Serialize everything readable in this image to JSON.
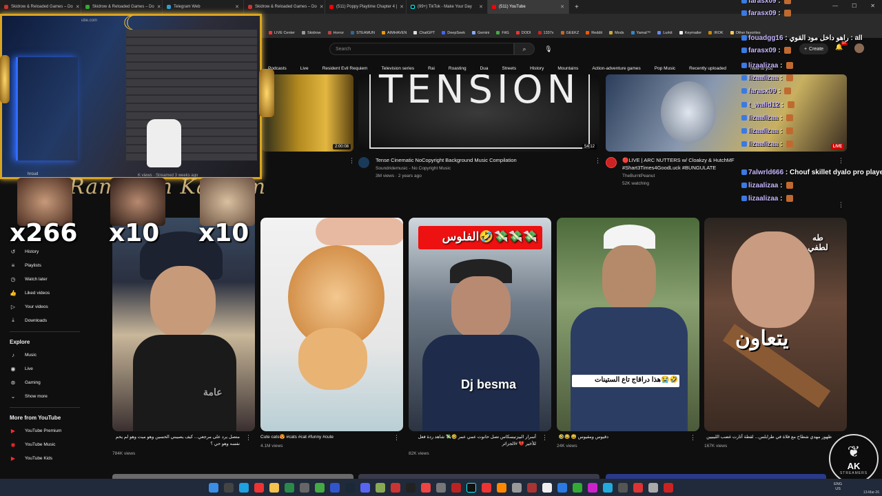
{
  "tabs": [
    {
      "label": "Skidrow & Reloaded Games – Do"
    },
    {
      "label": "Skidrow & Reloaded Games – Do"
    },
    {
      "label": "Telegram Web"
    },
    {
      "label": "Skidrow & Reloaded Games – Do"
    },
    {
      "label": "(511) Poppy Playtime Chapter 4 |"
    },
    {
      "label": "(99+) TikTok - Make Your Day"
    },
    {
      "label": "(511) YouTube"
    }
  ],
  "bookmarks": [
    "LIVE Center",
    "Skidrow",
    "Horror",
    "STEAMUN",
    "AIMHAVEN",
    "ChatGPT",
    "DeepSeek",
    "Gemini",
    "FitG",
    "DODI",
    "1337x",
    "GEEKZ",
    "Reddit",
    "Mods",
    "Yamal™",
    "Lurkit",
    "Keymailer",
    "IROK",
    "Other favorites"
  ],
  "header": {
    "search_placeholder": "Search",
    "create_label": "Create",
    "notif_badge": "9+"
  },
  "chips": [
    "Podcasts",
    "Live",
    "Resident Evil Requiem",
    "Television series",
    "Rai",
    "Roasting",
    "Dua",
    "Streets",
    "History",
    "Mountains",
    "Action-adventure games",
    "Pop Music",
    "Recently uploaded",
    "New to you"
  ],
  "sidebar": {
    "items": [
      {
        "label": "History",
        "icon": "history-icon"
      },
      {
        "label": "Playlists",
        "icon": "playlists-icon"
      },
      {
        "label": "Watch later",
        "icon": "clock-icon"
      },
      {
        "label": "Liked videos",
        "icon": "thumbs-up-icon"
      },
      {
        "label": "Your videos",
        "icon": "play-icon"
      },
      {
        "label": "Downloads",
        "icon": "download-icon"
      }
    ],
    "explore_heading": "Explore",
    "explore": [
      {
        "label": "Music",
        "icon": "music-icon"
      },
      {
        "label": "Live",
        "icon": "live-icon"
      },
      {
        "label": "Gaming",
        "icon": "gamepad-icon"
      },
      {
        "label": "Show more",
        "icon": "chevron-down-icon"
      }
    ],
    "more_heading": "More from YouTube",
    "more": [
      {
        "label": "YouTube Premium"
      },
      {
        "label": "YouTube Music"
      },
      {
        "label": "YouTube Kids"
      }
    ]
  },
  "overlay": {
    "site_text": "ube.com",
    "ramadan_text": "Ramadan Kareem",
    "counts": [
      "x266",
      "x10",
      "x10"
    ],
    "peek_meta": "K views · Streamed 3 weeks ago",
    "peek_channel": "hroud"
  },
  "videos": [
    {
      "duration": "2:00:08"
    },
    {
      "title": "Tense Cinematic NoCopyright Background Music Compilation",
      "channel": "Soundridemusic - No Copyright Music",
      "meta": "3M views · 2 years ago",
      "duration": "54:12",
      "thumb_text": "TENSION"
    },
    {
      "title_line1": "🔴LIVE | ARC NUTTERS w/ Cloakzy & HutchMF",
      "title_line2": "#Shart3Times4GoodLuck #BUNGULATE",
      "channel": "TheBurntPeanut",
      "meta": "52K watching",
      "live_label": "LIVE"
    }
  ],
  "shorts": [
    {
      "title": "متصل يرد على مرجعي... كيف يصيبني الحسين وهو ميت وهو لم يحم نفسه وهو حي ؟",
      "views": "784K views",
      "caption": "عامة"
    },
    {
      "title": "Cute cats😍 #cats #cat #funny #cute",
      "views": "4.1M views"
    },
    {
      "title": "أسرار البيزنيسكاس تصل حانوت عمي عمر 🤣💸 شاهد ردة فعل للأخير 💔 #الجزائر",
      "views": "82K views",
      "caption": "Dj besma",
      "banner": "الفلوس🤣💸💸💸"
    },
    {
      "title": "🤣😂 😅 دقيوس ومقيوس",
      "views": "24K views",
      "caption": "هذا دراقاج تاع الستينات😭🤣"
    },
    {
      "title": "ظهور مهدي شطاح مع فلاة في طرابلس... لقطة أثارت غضب الليبيين",
      "views": "167K views",
      "caption": "يتعاون",
      "corner": "طه لطفي"
    }
  ],
  "chat": [
    {
      "user": "farasx09",
      "msg": "",
      "color": "#c9b8ff"
    },
    {
      "user": "farasx09",
      "msg": "",
      "color": "#c9b8ff"
    },
    {
      "user": "fouadgg16",
      "msg": "راهو داخل مود القوي : all",
      "color": "#c9b8ff"
    },
    {
      "user": "farasx09",
      "msg": "",
      "color": "#c9b8ff"
    },
    {
      "user": "lizaalizaa",
      "msg": "",
      "color": "#c9b8ff"
    },
    {
      "user": "lizaalizaa",
      "msg": "",
      "color": "#c9b8ff"
    },
    {
      "user": "farasx09",
      "msg": "",
      "color": "#c9b8ff"
    },
    {
      "user": "t_walid12",
      "msg": "",
      "color": "#c9b8ff"
    },
    {
      "user": "lizaalizaa",
      "msg": "",
      "color": "#c9b8ff"
    },
    {
      "user": "lizaalizaa",
      "msg": "",
      "color": "#c9b8ff"
    },
    {
      "user": "lizaalizaa",
      "msg": "",
      "color": "#c9b8ff"
    },
    {
      "user": "7alwrld666",
      "msg": "Chouf skillet dyalo pro player",
      "color": "#c9b8ff"
    },
    {
      "user": "lizaalizaa",
      "msg": "",
      "color": "#c9b8ff"
    },
    {
      "user": "lizaalizaa",
      "msg": "",
      "color": "#c9b8ff"
    }
  ],
  "logo": {
    "top": "AK",
    "bottom": "STREAMERS"
  },
  "tray": {
    "lang1": "ENG",
    "lang2": "US",
    "date": "13-Mar-26"
  }
}
